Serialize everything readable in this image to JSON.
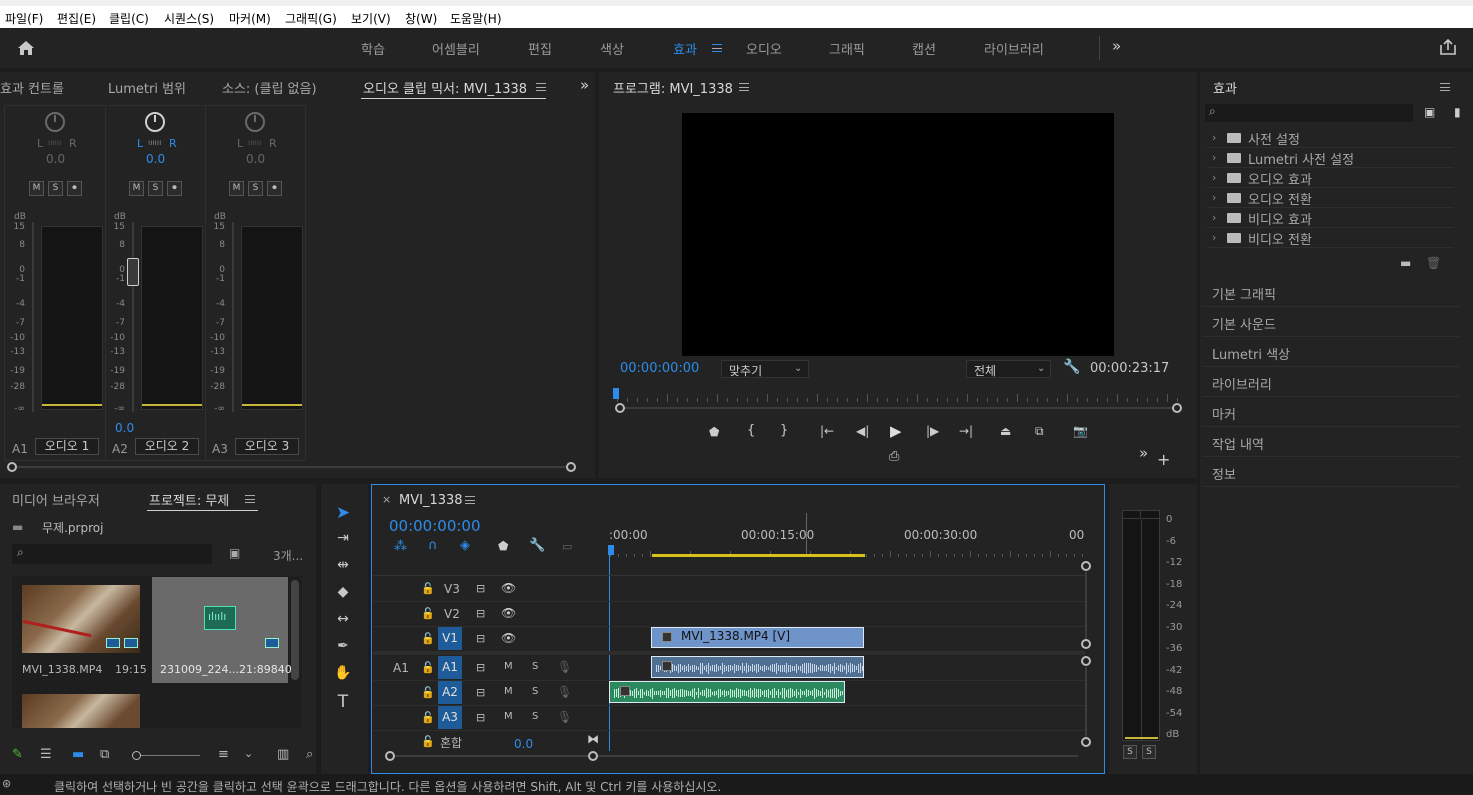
{
  "menu": [
    "파일(F)",
    "편집(E)",
    "클립(C)",
    "시퀀스(S)",
    "마커(M)",
    "그래픽(G)",
    "보기(V)",
    "창(W)",
    "도움말(H)"
  ],
  "workspaces": {
    "items": [
      "학습",
      "어셈블리",
      "편집",
      "색상",
      "효과",
      "오디오",
      "그래픽",
      "캡션",
      "라이브러리"
    ],
    "active": "효과"
  },
  "left_panel": {
    "tabs": [
      "효과 컨트롤",
      "Lumetri 범위",
      "소스: (클립 없음)",
      "오디오 클립 믹서: MVI_1338"
    ],
    "channels": [
      {
        "lr": "L",
        "r": "R",
        "value": "0.0",
        "track": "A1",
        "name": "오디오 1"
      },
      {
        "lr": "L",
        "r": "R",
        "value": "0.0",
        "track": "A2",
        "name": "오디오 2",
        "fader_value": "0.0"
      },
      {
        "lr": "L",
        "r": "R",
        "value": "0.0",
        "track": "A3",
        "name": "오디오 3"
      }
    ],
    "buttons": [
      "M",
      "S"
    ],
    "db_label": "dB",
    "scale": [
      "15",
      "8",
      "0",
      "-1",
      "-4",
      "-7",
      "-10",
      "-13",
      "-19",
      "-28",
      "-∞"
    ]
  },
  "program": {
    "title": "프로그램: MVI_1338",
    "timecode": "00:00:00:00",
    "fit": "맞추기",
    "quality": "전체",
    "duration": "00:00:23:17"
  },
  "effects_panel": {
    "title": "효과",
    "items": [
      "사전 설정",
      "Lumetri 사전 설정",
      "오디오 효과",
      "오디오 전환",
      "비디오 효과",
      "비디오 전환"
    ],
    "sections": [
      "기본 그래픽",
      "기본 사운드",
      "Lumetri 색상",
      "라이브러리",
      "마커",
      "작업 내역",
      "정보"
    ]
  },
  "project": {
    "tabs": [
      "미디어 브라우저",
      "프로젝트: 무제"
    ],
    "file": "무제.prproj",
    "count": "3개...",
    "items": [
      {
        "name": "MVI_1338.MP4",
        "duration": "19:15"
      },
      {
        "name": "231009_224...",
        "duration": "21:89840"
      }
    ]
  },
  "timeline": {
    "tab": "MVI_1338",
    "timecode": "00:00:00:00",
    "ruler": [
      ":00:00",
      "00:00:15:00",
      "00:00:30:00",
      "00"
    ],
    "video_tracks": [
      "V3",
      "V2",
      "V1"
    ],
    "audio_tracks": [
      "A1",
      "A2",
      "A3"
    ],
    "source_patch": "A1",
    "mix_label": "혼합",
    "mix_value": "0.0",
    "video_clip": "MVI_1338.MP4 [V]",
    "track_buttons": [
      "M",
      "S"
    ]
  },
  "audio_meter": {
    "scale": [
      "0",
      "-6",
      "-12",
      "-18",
      "-24",
      "-30",
      "-36",
      "-42",
      "-48",
      "-54",
      "dB"
    ],
    "solo": [
      "S",
      "S"
    ]
  },
  "status": "클릭하여 선택하거나 빈 공간을 클릭하고 선택 윤곽으로 드래그합니다. 다른 옵션을 사용하려면 Shift, Alt 및 Ctrl 키를 사용하십시오.",
  "colors": {
    "accent": "#2d8ceb",
    "clip_video": "#6f94c9",
    "clip_audio_a1": "#4f6f93",
    "clip_audio_a2": "#2a8a5e",
    "track_active": "#1d5c99",
    "workarea": "#d9c21a"
  }
}
